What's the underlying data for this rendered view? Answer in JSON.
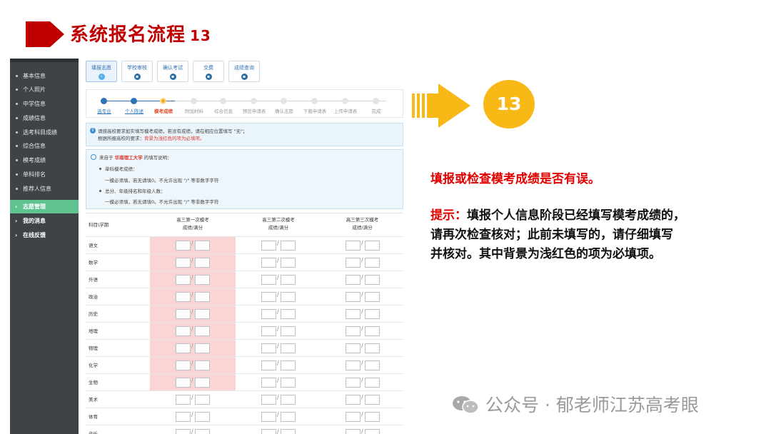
{
  "slide": {
    "title": "系统报名流程",
    "title_num": "13",
    "step_badge": "13",
    "description": "填报或检查模考成绩是否有误。",
    "tip_label": "提示：",
    "tip_lines": [
      "填报个人信息阶段已经填写模考成绩的，",
      "请再次检查核对；此前未填写的，请仔细填写",
      "并核对。其中背景为浅红色的项为必填项。"
    ],
    "watermark": "公众号 · 郁老师江苏高考眼"
  },
  "colors": {
    "title_red": "#c00000",
    "badge_yellow": "#f8b816",
    "nav_bg": "#3d4346",
    "nav_active": "#5fc38f",
    "required_pink": "#fbd4d6"
  },
  "sidebar": {
    "items": [
      {
        "label": "基本信息"
      },
      {
        "label": "个人照片"
      },
      {
        "label": "中学信息"
      },
      {
        "label": "成绩信息"
      },
      {
        "label": "选考科目成绩"
      },
      {
        "label": "综合信息"
      },
      {
        "label": "模考成绩"
      },
      {
        "label": "单科排名"
      },
      {
        "label": "推荐人信息"
      }
    ],
    "groups": [
      {
        "label": "志愿管理"
      },
      {
        "label": "我的消息"
      },
      {
        "label": "在线反馈"
      }
    ]
  },
  "tabs": [
    {
      "label": "填报志愿",
      "icon": "check-circle-icon"
    },
    {
      "label": "学校审核",
      "icon": "lock-icon"
    },
    {
      "label": "确认考试",
      "icon": "lock-icon"
    },
    {
      "label": "交费",
      "icon": "lock-icon"
    },
    {
      "label": "成绩查询",
      "icon": "lock-icon"
    }
  ],
  "steps": [
    {
      "label": "选专业"
    },
    {
      "label": "个人陈述"
    },
    {
      "label": "模考成绩"
    },
    {
      "label": "附加材料"
    },
    {
      "label": "综合信息"
    },
    {
      "label": "预览申请表"
    },
    {
      "label": "确认志愿"
    },
    {
      "label": "下载申请表"
    },
    {
      "label": "上传申请表"
    },
    {
      "label": "完成"
    }
  ],
  "notice": {
    "line1": "请按高校要求如实填写模考成绩，若没有成绩，请在相应位置填写 \"无\"；",
    "line2_prefix": "根据所报高校的要求：",
    "line2_red": "背景为浅红色的项为必填项。"
  },
  "hint": {
    "prefix": "来自于",
    "school": "华南理工大学",
    "suffix": "的填写说明：",
    "b1_title": "单科模考成绩：",
    "b1_text": "一模必须填，若无请填0。不允许出现 \"/\" 等非数字字符",
    "b2_title": "总分、年级排名和年级人数：",
    "b2_text": "一模必须填，若无请填0。不允许出现 \"/\" 等非数字字符"
  },
  "table": {
    "corner_header": "科目\\学期",
    "columns": [
      {
        "title": "高三第一次模考",
        "sub": "成绩/满分"
      },
      {
        "title": "高三第二次模考",
        "sub": "成绩/满分"
      },
      {
        "title": "高三第三次模考",
        "sub": "成绩/满分"
      }
    ],
    "slash": "/",
    "rows": [
      {
        "subject": "语文"
      },
      {
        "subject": "数学"
      },
      {
        "subject": "外语"
      },
      {
        "subject": "政治"
      },
      {
        "subject": "历史"
      },
      {
        "subject": "地理"
      },
      {
        "subject": "物理"
      },
      {
        "subject": "化学"
      },
      {
        "subject": "生物"
      },
      {
        "subject": "美术"
      },
      {
        "subject": "体育"
      },
      {
        "subject": "音乐"
      }
    ]
  }
}
